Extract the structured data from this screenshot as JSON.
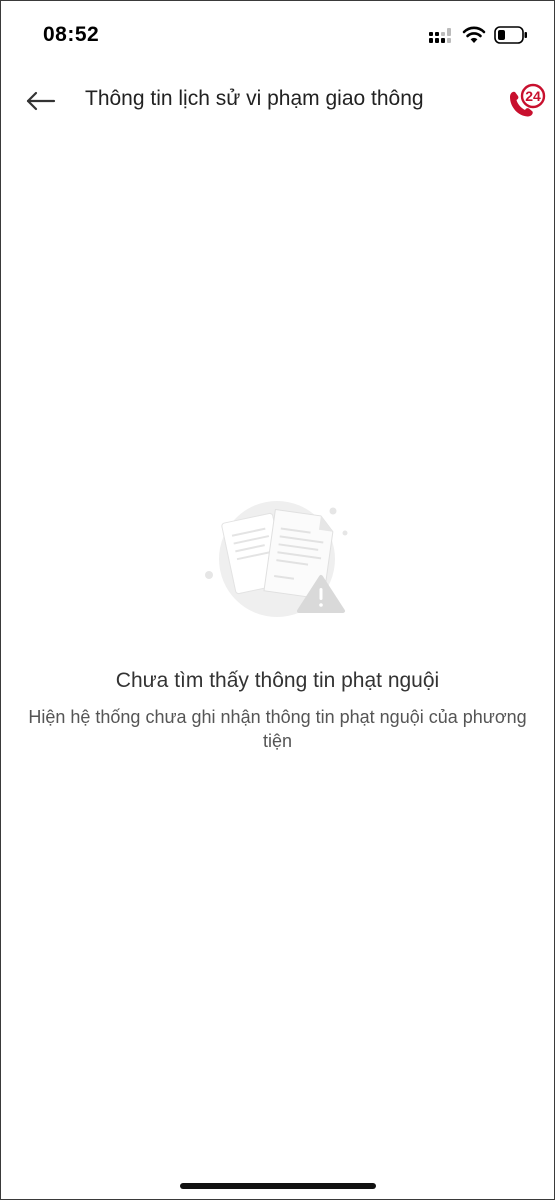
{
  "status_bar": {
    "time": "08:52"
  },
  "header": {
    "title": "Thông tin lịch sử vi phạm giao thông",
    "hotline_badge": "24"
  },
  "empty_state": {
    "title": "Chưa tìm thấy thông tin phạt nguội",
    "description": "Hiện hệ thống chưa ghi nhận thông tin phạt nguội của phương tiện"
  },
  "colors": {
    "accent_red": "#c8102e",
    "title_text": "#222222",
    "muted_text": "#555555"
  },
  "icons": {
    "back": "arrow-left-icon",
    "hotline": "phone-24-icon",
    "empty": "documents-warning-icon"
  }
}
